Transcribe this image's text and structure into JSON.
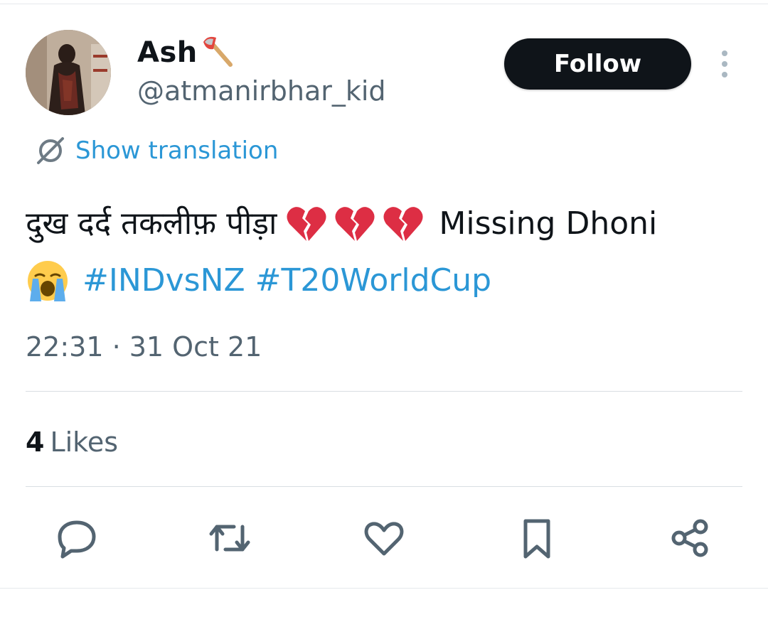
{
  "user": {
    "display_name": "Ash",
    "name_emoji": "axe",
    "handle": "@atmanirbhar_kid"
  },
  "follow_label": "Follow",
  "translate_label": "Show translation",
  "tweet": {
    "hindi_text": "दुख दर्द तकलीफ़ पीड़ा",
    "hearts": [
      "broken-heart",
      "broken-heart",
      "broken-heart"
    ],
    "text_after": "Missing Dhoni",
    "line2_emoji": "loudly-crying-face",
    "hashtags": [
      "#INDvsNZ",
      "#T20WorldCup"
    ]
  },
  "timestamp": "22:31 · 31 Oct 21",
  "likes": {
    "count": "4",
    "label": "Likes"
  },
  "actions": [
    "reply-icon",
    "retweet-icon",
    "like-icon",
    "bookmark-icon",
    "share-icon"
  ],
  "colors": {
    "accent": "#1d9bf0",
    "text": "#0f1419",
    "muted": "#536471"
  }
}
